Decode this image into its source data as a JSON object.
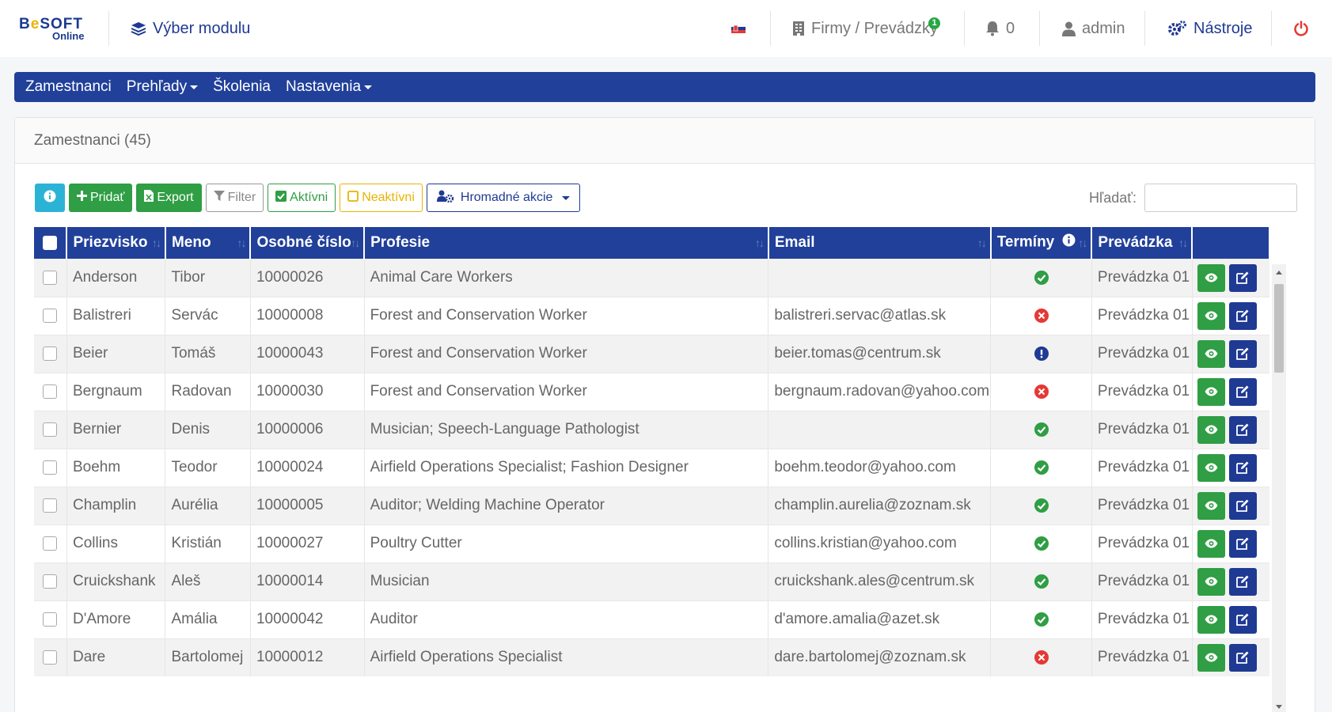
{
  "brand": {
    "name_part1": "B",
    "name_e": "e",
    "name_part2": "SOFT",
    "sub": "Online"
  },
  "header": {
    "module_label": "Výber modulu",
    "firms_label": "Firmy / Prevádzky",
    "firms_badge": "1",
    "notifications_count": "0",
    "user_label": "admin",
    "tools_label": "Nástroje"
  },
  "nav": {
    "items": [
      {
        "label": "Zamestnanci",
        "dropdown": false
      },
      {
        "label": "Prehľady",
        "dropdown": true
      },
      {
        "label": "Školenia",
        "dropdown": false
      },
      {
        "label": "Nastavenia",
        "dropdown": true
      }
    ]
  },
  "card": {
    "title": "Zamestnanci (45)"
  },
  "toolbar": {
    "add_label": "Pridať",
    "export_label": "Export",
    "filter_label": "Filter",
    "active_label": "Aktívni",
    "inactive_label": "Neaktívni",
    "bulk_label": "Hromadné akcie"
  },
  "search": {
    "label": "Hľadať:",
    "value": ""
  },
  "table": {
    "columns": [
      "Priezvisko",
      "Meno",
      "Osobné číslo",
      "Profesie",
      "Email",
      "Termíny",
      "Prevádzka"
    ],
    "rows": [
      {
        "surname": "Anderson",
        "name": "Tibor",
        "number": "10000026",
        "profession": "Animal Care Workers",
        "email": "",
        "status": "ok",
        "branch": "Prevádzka 01"
      },
      {
        "surname": "Balistreri",
        "name": "Servác",
        "number": "10000008",
        "profession": "Forest and Conservation Worker",
        "email": "balistreri.servac@atlas.sk",
        "status": "err",
        "branch": "Prevádzka 01"
      },
      {
        "surname": "Beier",
        "name": "Tomáš",
        "number": "10000043",
        "profession": "Forest and Conservation Worker",
        "email": "beier.tomas@centrum.sk",
        "status": "warn",
        "branch": "Prevádzka 01"
      },
      {
        "surname": "Bergnaum",
        "name": "Radovan",
        "number": "10000030",
        "profession": "Forest and Conservation Worker",
        "email": "bergnaum.radovan@yahoo.com",
        "status": "err",
        "branch": "Prevádzka 01"
      },
      {
        "surname": "Bernier",
        "name": "Denis",
        "number": "10000006",
        "profession": "Musician; Speech-Language Pathologist",
        "email": "",
        "status": "ok",
        "branch": "Prevádzka 01"
      },
      {
        "surname": "Boehm",
        "name": "Teodor",
        "number": "10000024",
        "profession": "Airfield Operations Specialist; Fashion Designer",
        "email": "boehm.teodor@yahoo.com",
        "status": "ok",
        "branch": "Prevádzka 01"
      },
      {
        "surname": "Champlin",
        "name": "Aurélia",
        "number": "10000005",
        "profession": "Auditor; Welding Machine Operator",
        "email": "champlin.aurelia@zoznam.sk",
        "status": "ok",
        "branch": "Prevádzka 01"
      },
      {
        "surname": "Collins",
        "name": "Kristián",
        "number": "10000027",
        "profession": "Poultry Cutter",
        "email": "collins.kristian@yahoo.com",
        "status": "ok",
        "branch": "Prevádzka 01"
      },
      {
        "surname": "Cruickshank",
        "name": "Aleš",
        "number": "10000014",
        "profession": "Musician",
        "email": "cruickshank.ales@centrum.sk",
        "status": "ok",
        "branch": "Prevádzka 01"
      },
      {
        "surname": "D'Amore",
        "name": "Amália",
        "number": "10000042",
        "profession": "Auditor",
        "email": "d'amore.amalia@azet.sk",
        "status": "ok",
        "branch": "Prevádzka 01"
      },
      {
        "surname": "Dare",
        "name": "Bartolomej",
        "number": "10000012",
        "profession": "Airfield Operations Specialist",
        "email": "dare.bartolomej@zoznam.sk",
        "status": "err",
        "branch": "Prevádzka 01"
      }
    ]
  },
  "icons": {
    "module": "layers-icon",
    "flag": "flag-sk-icon",
    "firms": "building-icon",
    "bell": "bell-icon",
    "user": "user-icon",
    "tools": "cogs-icon",
    "power": "power-icon"
  },
  "colors": {
    "primary": "#21409a",
    "success": "#2f9e44",
    "danger": "#e53935",
    "info": "#2bb3d6",
    "warning": "#e8b400"
  }
}
